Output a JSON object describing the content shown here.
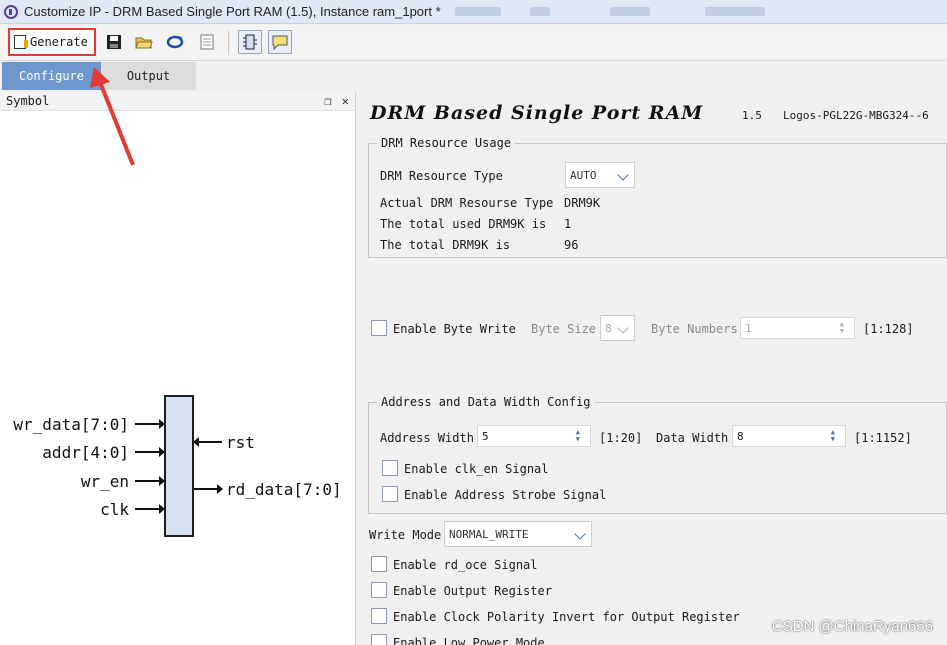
{
  "window": {
    "title": "Customize IP - DRM Based Single Port RAM (1.5), Instance ram_1port *"
  },
  "toolbar": {
    "generate_label": "Generate"
  },
  "tabs": [
    {
      "label": "Configure"
    },
    {
      "label": "Output"
    }
  ],
  "symbol": {
    "header": "Symbol",
    "pins_left": [
      "wr_data[7:0]",
      "addr[4:0]",
      "wr_en",
      "clk"
    ],
    "pins_right": [
      "rst",
      "rd_data[7:0]"
    ]
  },
  "ip": {
    "title": "DRM Based Single Port RAM",
    "version": "1.5",
    "device": "Logos-PGL22G-MBG324--6"
  },
  "drm_usage": {
    "title": "DRM Resource Usage",
    "type_label": "DRM Resource Type",
    "type_value": "AUTO",
    "actual_label": "Actual DRM Resourse Type",
    "actual_value": "DRM9K",
    "used_label": "The total used DRM9K is",
    "used_value": "1",
    "total_label": "The total DRM9K is",
    "total_value": "96"
  },
  "byte_write": {
    "enable_label": "Enable Byte Write",
    "byte_size_label": "Byte Size",
    "byte_size_value": "8",
    "byte_numbers_label": "Byte Numbers",
    "byte_numbers_value": "1",
    "byte_numbers_range": "[1:128]"
  },
  "addr_data": {
    "title": "Address and Data Width Config",
    "addr_width_label": "Address Width",
    "addr_width_value": "5",
    "addr_width_range": "[1:20]",
    "data_width_label": "Data Width",
    "data_width_value": "8",
    "data_width_range": "[1:1152]",
    "clk_en_label": "Enable clk_en Signal",
    "addr_strobe_label": "Enable Address Strobe Signal"
  },
  "write_mode": {
    "label": "Write Mode",
    "value": "NORMAL_WRITE"
  },
  "options": {
    "rd_oce": "Enable rd_oce Signal",
    "output_register": "Enable Output Register",
    "clock_polarity": "Enable Clock Polarity Invert for Output Register",
    "low_power": "Enable Low Power Mode"
  },
  "watermark": "CSDN @ChinaRyan666",
  "colors": {
    "tab_active": "#6d97cf",
    "highlight": "#e53935",
    "block_fill": "#d4e1f2"
  }
}
